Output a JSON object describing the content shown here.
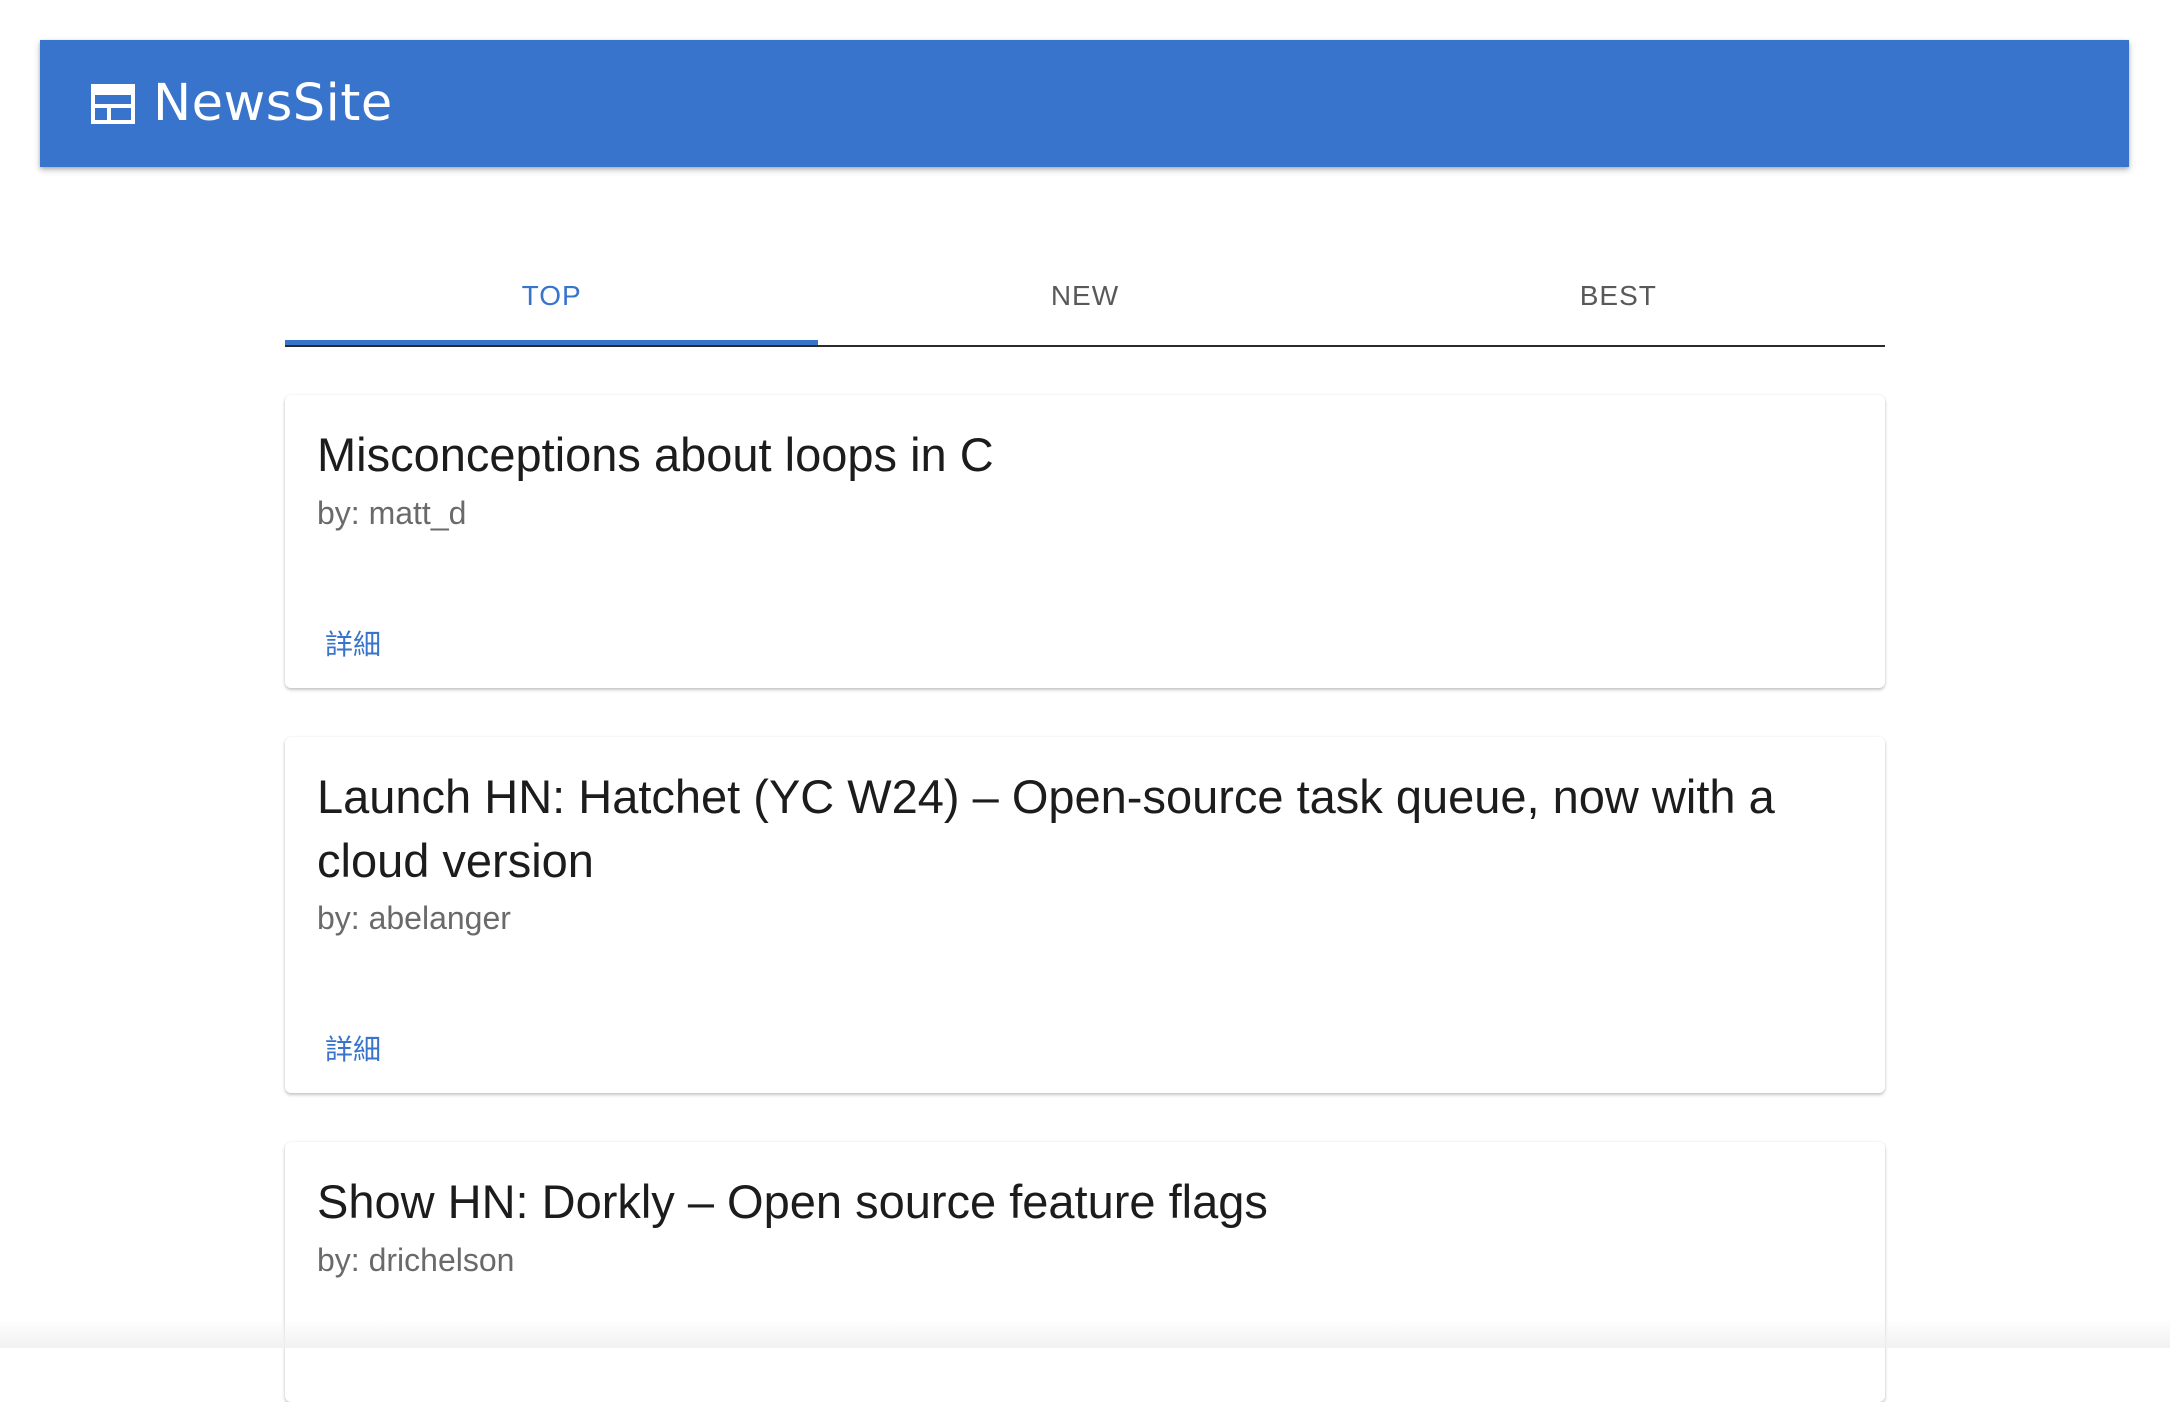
{
  "header": {
    "logo_icon": "newspaper-icon",
    "title": "NewsSite",
    "background_color": "#3874cb"
  },
  "tabs": [
    {
      "label": "TOP",
      "active": true
    },
    {
      "label": "NEW",
      "active": false
    },
    {
      "label": "BEST",
      "active": false
    }
  ],
  "stories": [
    {
      "title": "Misconceptions about loops in C",
      "author": "by: matt_d",
      "action_label": "詳細"
    },
    {
      "title": "Launch HN: Hatchet (YC W24) – Open-source task queue, now with a cloud version",
      "author": "by: abelanger",
      "action_label": "詳細"
    },
    {
      "title": "Show HN: Dorkly – Open source feature flags",
      "author": "by: drichelson"
    }
  ],
  "accent_color": "#3874cb"
}
